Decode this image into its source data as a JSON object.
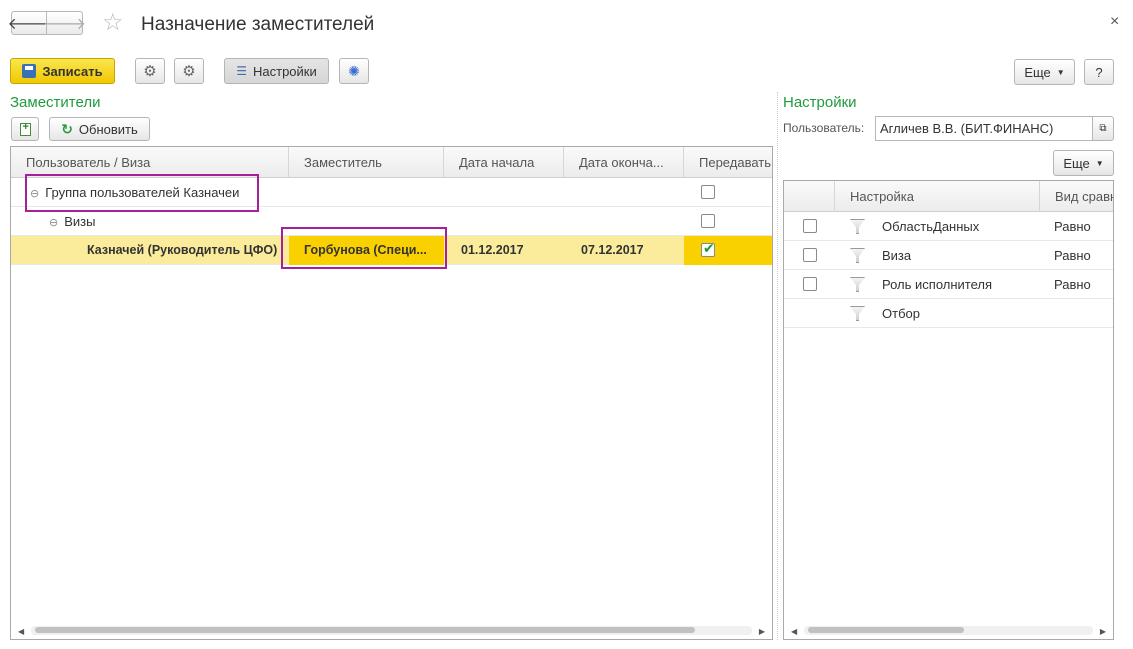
{
  "window": {
    "title": "Назначение заместителей",
    "close_glyph": "×"
  },
  "toolbar": {
    "save_label": "Записать",
    "settings_label": "Настройки",
    "more_label": "Еще",
    "help_label": "?"
  },
  "deputies": {
    "caption": "Заместители",
    "refresh_label": "Обновить",
    "columns": [
      "Пользователь / Виза",
      "Заместитель",
      "Дата начала",
      "Дата оконча...",
      "Передавать"
    ],
    "rows": [
      {
        "label": "Группа пользователей Казначеи",
        "checked": false
      },
      {
        "label": "Визы",
        "checked": false
      },
      {
        "user": "Казначей (Руководитель ЦФО)",
        "deputy": "Горбунова (Специ...",
        "date_start": "01.12.2017",
        "date_end": "07.12.2017",
        "checked": true
      }
    ]
  },
  "settings_panel": {
    "caption": "Настройки",
    "user_label": "Пользователь:",
    "user_value": "Агличев В.В. (БИТ.ФИНАНС)",
    "more_label": "Еще",
    "columns": [
      "Настройка",
      "Вид сравн"
    ],
    "rows": [
      {
        "name": "ОбластьДанных",
        "compare": "Равно",
        "has_checkbox": true
      },
      {
        "name": "Виза",
        "compare": "Равно",
        "has_checkbox": true
      },
      {
        "name": "Роль исполнителя",
        "compare": "Равно",
        "has_checkbox": true
      },
      {
        "name": "Отбор",
        "compare": "",
        "has_checkbox": false
      }
    ]
  },
  "colors": {
    "accent_green": "#1e9c3c",
    "selection_row": "#fbec9c",
    "active_cell": "#fad100",
    "highlight_frame": "#a6209a"
  }
}
